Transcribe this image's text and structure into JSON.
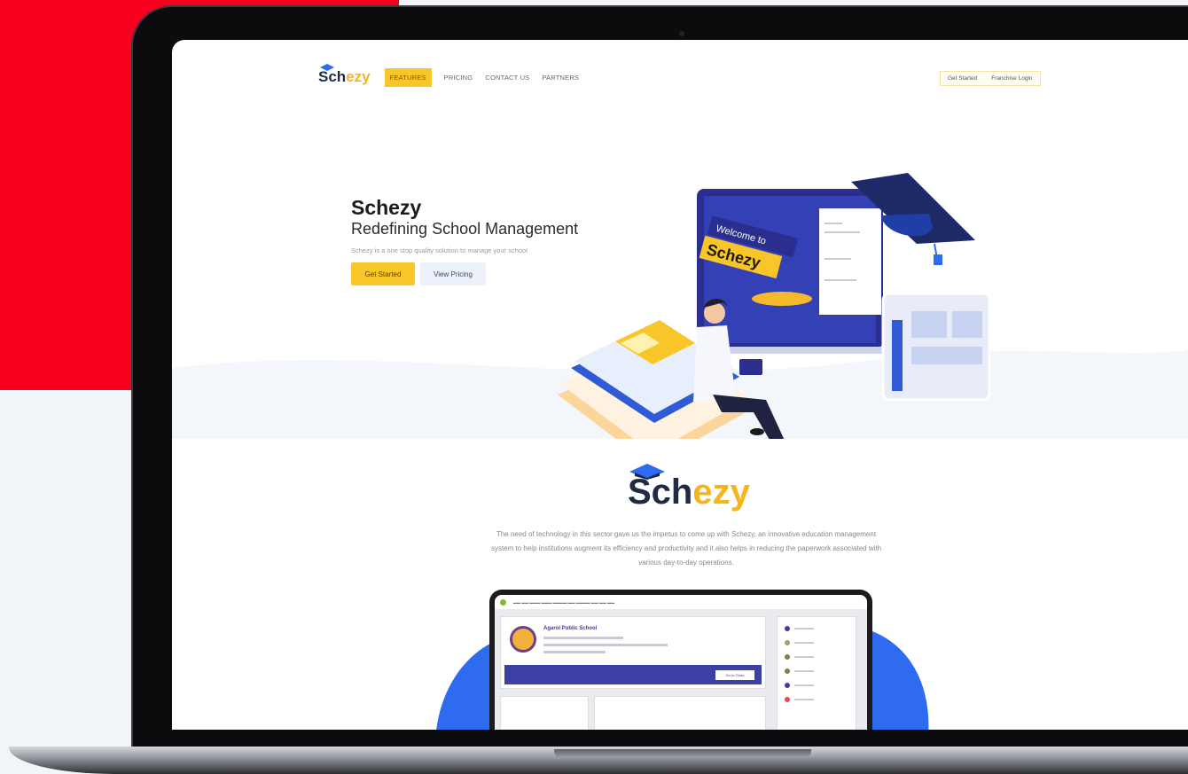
{
  "brand": {
    "part1": "Sch",
    "part2": "ezy",
    "colors": {
      "navy": "#1f2a44",
      "yellow": "#f5b51c",
      "red": "#f8001f",
      "blue": "#2f6bf0"
    }
  },
  "nav": {
    "items": [
      {
        "label": "FEATURES",
        "active": true
      },
      {
        "label": "PRICING"
      },
      {
        "label": "CONTACT US"
      },
      {
        "label": "PARTNERS"
      }
    ],
    "right": {
      "get_started": "Get Started",
      "franchise_login": "Franchise Login"
    }
  },
  "hero": {
    "title": "Schezy",
    "subtitle": "Redefining School Management",
    "description": "Schezy is a one stop quality solution to manage your school",
    "primary_button": "Get Started",
    "secondary_button": "View Pricing",
    "illustration": {
      "banner_text_1": "Welcome to",
      "banner_text_2": "Schezy"
    }
  },
  "about": {
    "text": "The need of technology in this sector gave us the impetus to come up with Schezy, an innovative education management system to help institutions augment its efficiency and productivity and it also helps in reducing the paperwork associated with various day-to-day operations."
  },
  "dashboard": {
    "school_name": "Agarol Public School",
    "bar_button": "Go to Class"
  },
  "icons": [
    "graduation-cap-icon",
    "school-crest-icon"
  ]
}
